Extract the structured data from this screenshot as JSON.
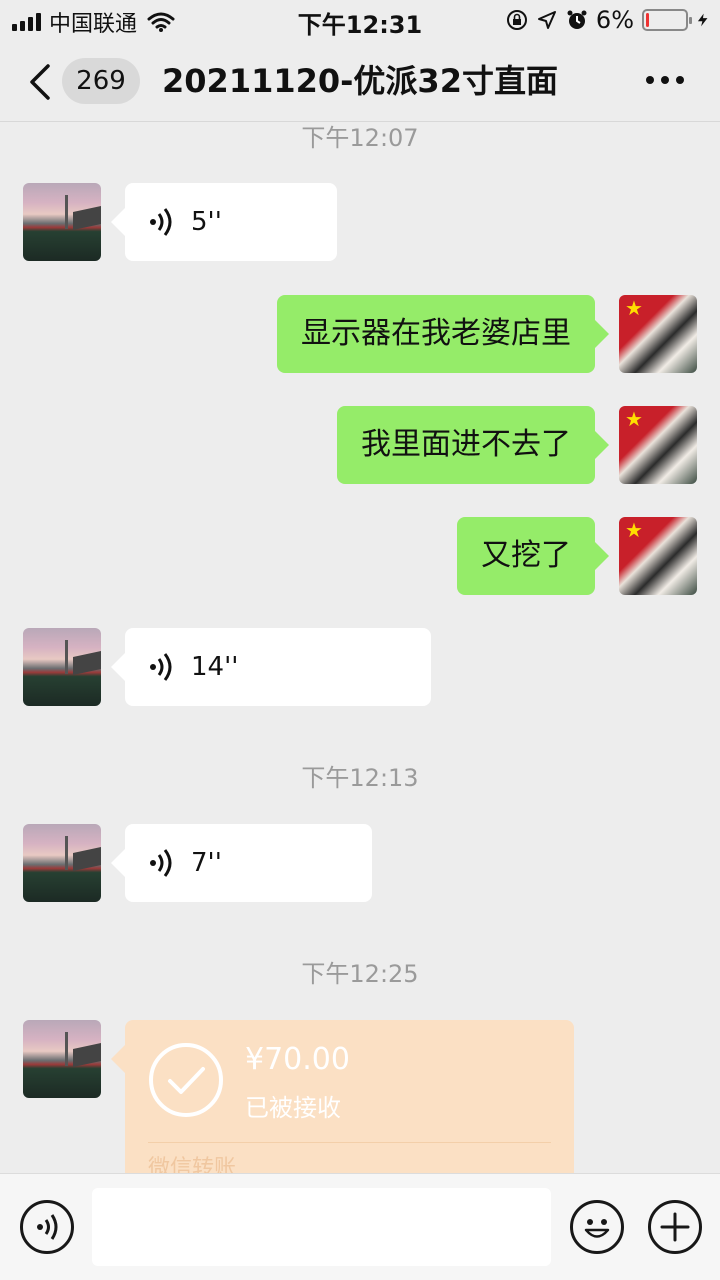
{
  "status_bar": {
    "carrier": "中国联通",
    "time": "下午12:31",
    "battery": "6%",
    "battery_level": 0.06,
    "icons": [
      "signal-icon",
      "wifi-icon",
      "lock-rotation-icon",
      "location-icon",
      "alarm-icon",
      "battery-icon",
      "charging-icon"
    ]
  },
  "nav": {
    "back_icon": "chevron-left-icon",
    "unread_count": "269",
    "title": "20211120-优派32寸直面",
    "more_icon": "more-dots-icon"
  },
  "messages": {
    "ts_1": "下午12:07",
    "voice_1": "5''",
    "text_1": "显示器在我老婆店里",
    "text_2": "我里面进不去了",
    "text_3": "又挖了",
    "voice_2": "14''",
    "ts_2": "下午12:13",
    "voice_3": "7''",
    "ts_3": "下午12:25",
    "transfer_amount": "¥70.00",
    "transfer_status": "已被接收",
    "transfer_label": "微信转账"
  },
  "input_bar": {
    "voice_icon": "voice-icon",
    "emoji_icon": "emoji-icon",
    "plus_icon": "plus-icon",
    "placeholder": ""
  },
  "colors": {
    "background": "#ededed",
    "my_bubble": "#95ec69",
    "their_bubble": "#ffffff",
    "transfer_bubble": "#fbe0c4",
    "battery_low": "#e33333"
  }
}
